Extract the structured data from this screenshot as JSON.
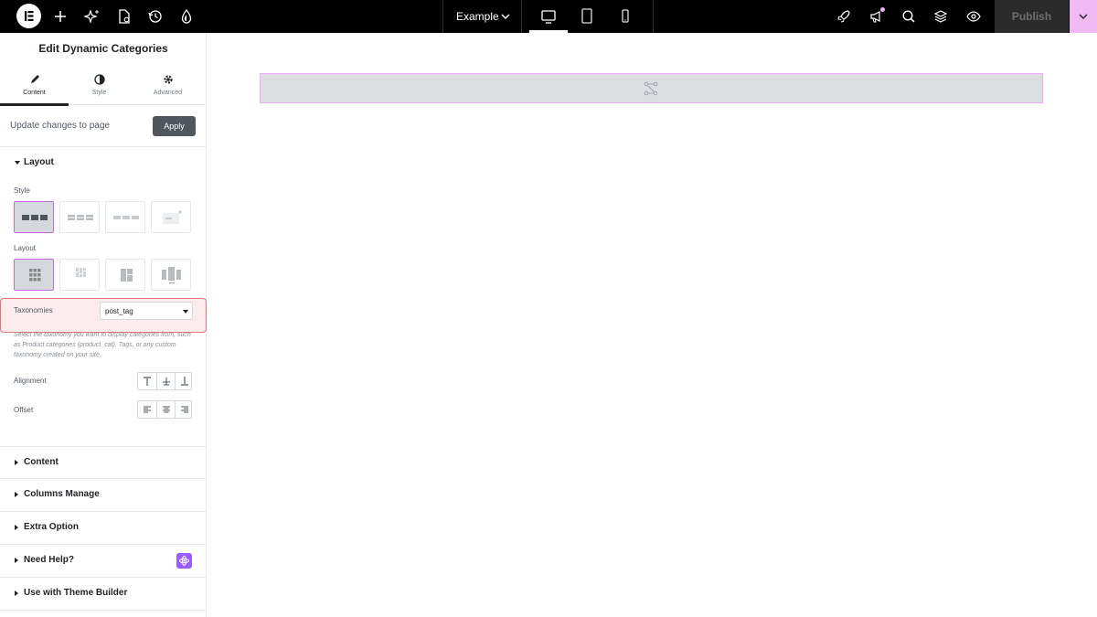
{
  "topbar": {
    "document_name": "Example",
    "publish_label": "Publish",
    "icons": [
      "elementor-logo-icon",
      "add-icon",
      "ai-sparkle-icon",
      "page-settings-icon",
      "history-icon",
      "site-settings-icon",
      "chevron-down-icon",
      "desktop-icon",
      "tablet-icon",
      "mobile-icon",
      "rocket-icon",
      "notifications-icon",
      "search-icon",
      "structure-icon",
      "preview-icon"
    ]
  },
  "panel": {
    "title": "Edit Dynamic Categories",
    "tabs": [
      {
        "label": "Content",
        "icon": "pencil-icon"
      },
      {
        "label": "Style",
        "icon": "half-circle-icon"
      },
      {
        "label": "Advanced",
        "icon": "gear-icon"
      }
    ],
    "update": {
      "label": "Update changes to page",
      "button": "Apply"
    },
    "layout_section": {
      "title": "Layout",
      "style_label": "Style",
      "layout_label": "Layout",
      "taxonomies_label": "Taxonomies",
      "taxonomies_value": "post_tag",
      "help_text": "Select the taxonomy you want to display categories from, such as Product categories (product_cat), Tags, or any custom taxonomy created on your site.",
      "alignment_label": "Alignment",
      "offset_label": "Offset"
    },
    "sections": [
      "Content",
      "Columns Manage",
      "Extra Option",
      "Need Help?",
      "Use with Theme Builder"
    ]
  },
  "colors": {
    "accent_pink": "#f0abfc",
    "highlight_red": "#e8707b",
    "need_help_badge": "#9b5cff"
  }
}
